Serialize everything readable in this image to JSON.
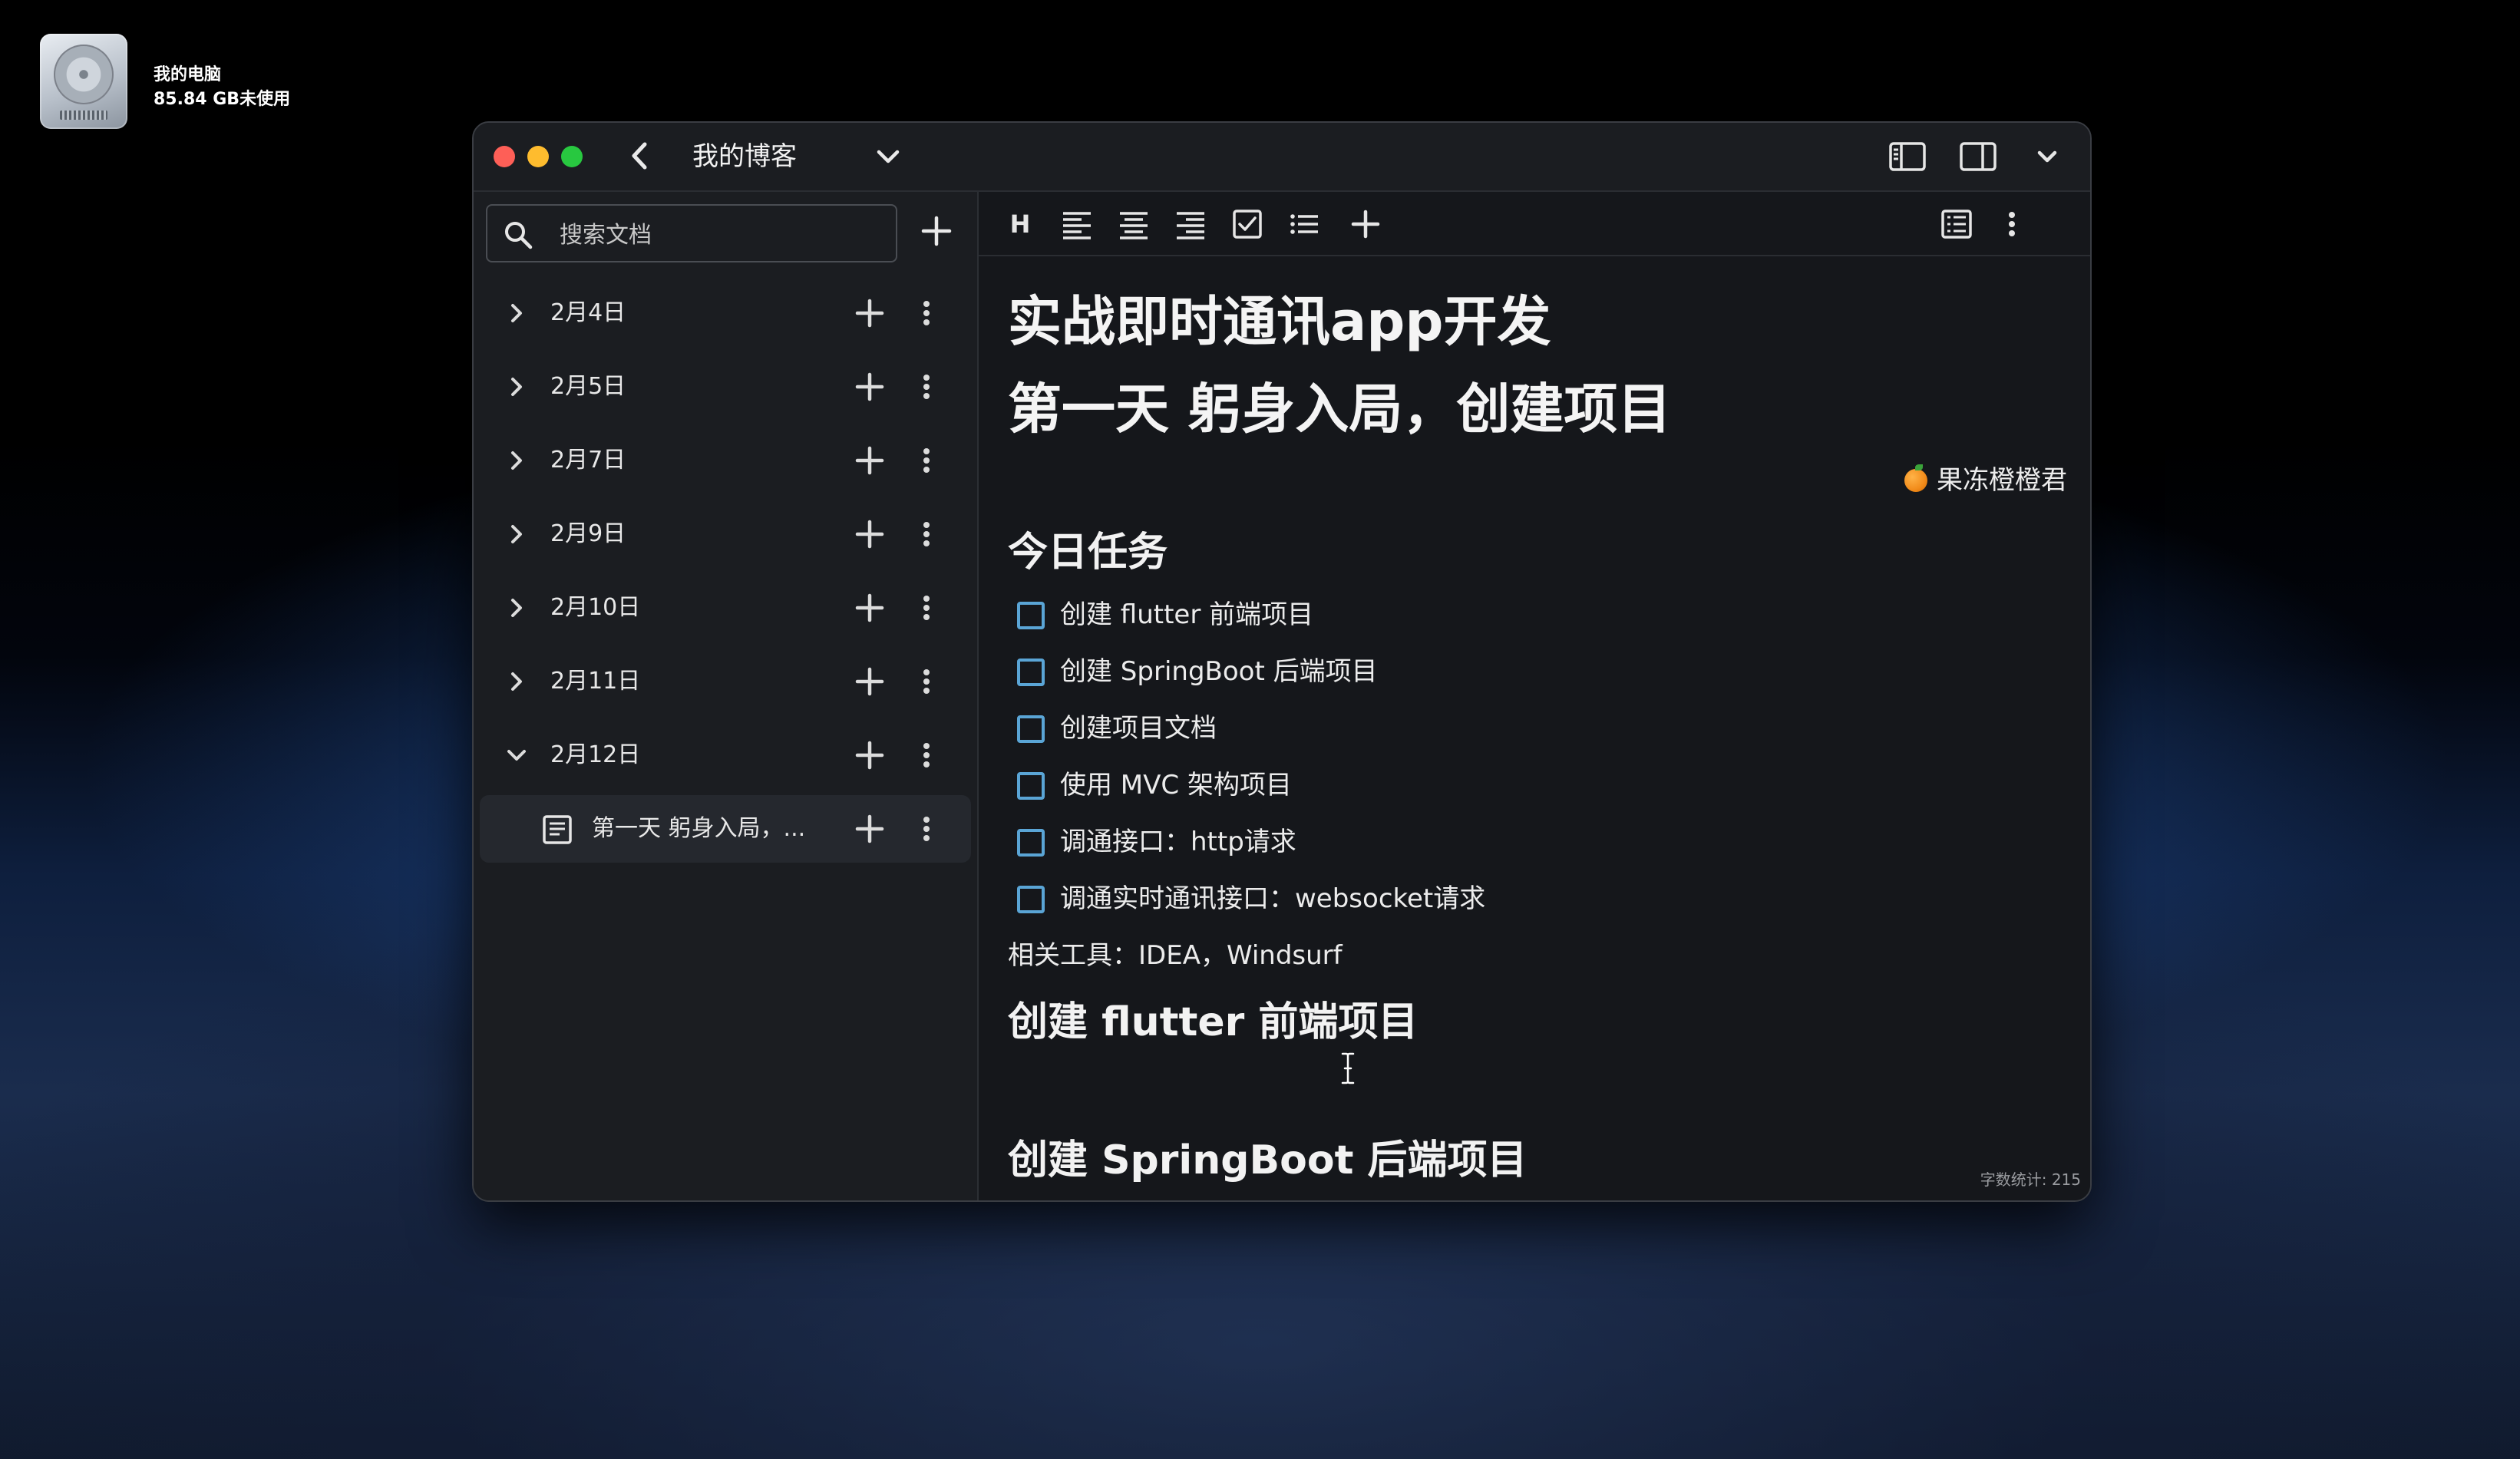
{
  "desktop": {
    "drive_name": "我的电脑",
    "drive_free": "85.84 GB未使用"
  },
  "window": {
    "title": "我的博客"
  },
  "sidebar": {
    "search_placeholder": "搜索文档",
    "items": [
      {
        "label": "2月4日",
        "expanded": false
      },
      {
        "label": "2月5日",
        "expanded": false
      },
      {
        "label": "2月7日",
        "expanded": false
      },
      {
        "label": "2月9日",
        "expanded": false
      },
      {
        "label": "2月10日",
        "expanded": false
      },
      {
        "label": "2月11日",
        "expanded": false
      },
      {
        "label": "2月12日",
        "expanded": true
      }
    ],
    "child": {
      "label": "第一天 躬身入局，..."
    }
  },
  "toolbar": {
    "heading_label": "H"
  },
  "document": {
    "title_line1": "实战即时通讯app开发",
    "title_line2": "第一天 躬身入局，创建项目",
    "author": "果冻橙橙君",
    "tasks_heading": "今日任务",
    "tasks": [
      {
        "label": "创建 flutter 前端项目",
        "checked": false
      },
      {
        "label": "创建 SpringBoot 后端项目",
        "checked": false
      },
      {
        "label": "创建项目文档",
        "checked": false
      },
      {
        "label": "使用 MVC 架构项目",
        "checked": false
      },
      {
        "label": "调通接口：http请求",
        "checked": false
      },
      {
        "label": "调通实时通讯接口：websocket请求",
        "checked": false
      }
    ],
    "tools_line": "相关工具：IDEA，Windsurf",
    "section1": "创建 flutter 前端项目",
    "section2": "创建 SpringBoot 后端项目"
  },
  "status": {
    "word_count": "字数统计: 215"
  },
  "colors": {
    "checkbox_border": "#5aa5d6",
    "traffic_red": "#fe5f57",
    "traffic_yellow": "#febc2e",
    "traffic_green": "#28c840"
  }
}
